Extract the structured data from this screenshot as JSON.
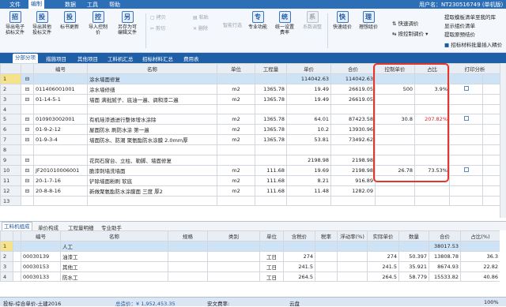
{
  "menu": {
    "file": "文件",
    "edit": "编制",
    "data": "数据",
    "tools": "工具",
    "help": "帮助",
    "user": "用户名：NT230516749 (单机版)"
  },
  "toolbar": {
    "btn1": "导出电子\n招标文件",
    "btn2": "导出其他\n投标文件",
    "btn3": "标书更新",
    "btn4": "导入控制\n价",
    "btn5": "另存为可\n编辑文件",
    "copy": "拷贝",
    "paste": "粘贴",
    "cut": "剪切",
    "del": "删除",
    "smart": "智能行选",
    "pro": "专业功能",
    "unify": "统一设置\n费率",
    "sys": "系数调整",
    "fast": "快速组价",
    "ideal": "理想组价",
    "fast_adjust": "快速调价",
    "ctrl_adjust": "按控制调价",
    "r1": "提取模板清单至我的库",
    "r2": "显示组价清单",
    "r3": "提取原预结价",
    "r4": "招标材料批量插入精价"
  },
  "main_tabs": [
    "分部分项",
    "措施项目",
    "其他项目",
    "工料机汇总",
    "招标材料汇总",
    "费用表"
  ],
  "grid1": {
    "headers": [
      "编号",
      "名称",
      "单位",
      "工程量",
      "单价",
      "合价",
      "控制单价",
      "占比",
      "打印分析"
    ],
    "rows": [
      {
        "n": "1",
        "code": "",
        "name": "涂水墙面修复",
        "unit": "",
        "qty": "",
        "price": "114042.63",
        "total": "114042.63",
        "cp": "",
        "pct": "",
        "cb": false,
        "sel": true
      },
      {
        "n": "2",
        "code": "011406001001",
        "name": "涂水墙修缮",
        "unit": "m2",
        "qty": "1365.78",
        "price": "19.49",
        "total": "26619.05",
        "cp": "500",
        "pct": "3.9%",
        "cb": true
      },
      {
        "n": "3",
        "code": "01-14-5-1",
        "name": "墙面 满批腻子、底油一遍、调和漆二遍",
        "unit": "m2",
        "qty": "1365.78",
        "price": "19.49",
        "total": "26619.05",
        "cp": "",
        "pct": "",
        "cb": false
      },
      {
        "n": "4",
        "code": "",
        "name": "",
        "unit": "",
        "qty": "",
        "price": "",
        "total": "",
        "cp": "",
        "pct": "",
        "cb": false
      },
      {
        "n": "5",
        "code": "010903002001",
        "name": "有机硅渗透进行整体增水涂除",
        "unit": "m2",
        "qty": "1365.78",
        "price": "64.01",
        "total": "87423.58",
        "cp": "30.8",
        "pct": "207.82%",
        "cb": true
      },
      {
        "n": "6",
        "code": "01-9-2-12",
        "name": "屋面防水 刷防水涂 第一遍",
        "unit": "m2",
        "qty": "1365.78",
        "price": "10.2",
        "total": "13930.96",
        "cp": "",
        "pct": "",
        "cb": false
      },
      {
        "n": "7",
        "code": "01-9-3-4",
        "name": "墙面防水、防潮 聚氨酯防水涂膜 2.0mm厚",
        "unit": "m2",
        "qty": "1365.78",
        "price": "53.81",
        "total": "73492.62",
        "cp": "",
        "pct": "",
        "cb": false
      },
      {
        "n": "8",
        "code": "",
        "name": "",
        "unit": "",
        "qty": "",
        "price": "",
        "total": "",
        "cp": "",
        "pct": "",
        "cb": false
      },
      {
        "n": "9",
        "code": "",
        "name": "花岗石窗台、立柱、勒脚、墙面修复",
        "unit": "",
        "qty": "",
        "price": "2198.98",
        "total": "2198.98",
        "cp": "",
        "pct": "",
        "cb": false
      },
      {
        "n": "10",
        "code": "JF201010006001",
        "name": "脆漆刺墙洗墙面",
        "unit": "m2",
        "qty": "111.68",
        "price": "19.69",
        "total": "2198.98",
        "cp": "26.78",
        "pct": "73.53%",
        "cb": true
      },
      {
        "n": "11",
        "code": "20-1-7-16",
        "name": "铲除墙面粉刷 软底",
        "unit": "m2",
        "qty": "111.68",
        "price": "8.21",
        "total": "916.89",
        "cp": "",
        "pct": "",
        "cb": false
      },
      {
        "n": "12",
        "code": "20-8-8-16",
        "name": "新做聚氨酯防水涂膜面 三度 厚2",
        "unit": "m2",
        "qty": "111.68",
        "price": "11.48",
        "total": "1282.09",
        "cp": "",
        "pct": "",
        "cb": false
      },
      {
        "n": "13",
        "code": "",
        "name": "",
        "unit": "",
        "qty": "",
        "price": "",
        "total": "",
        "cp": "",
        "pct": "",
        "cb": false
      }
    ]
  },
  "panel_tabs": [
    "工料机组成",
    "单价构成",
    "工程量明细",
    "专业助手"
  ],
  "grid2": {
    "headers": [
      "编号",
      "名称",
      "规格",
      "类别",
      "单位",
      "含税价",
      "税率",
      "浮动率(%)",
      "实际单价",
      "数量",
      "合价",
      "占比(%)"
    ],
    "rows": [
      {
        "n": "1",
        "code": "",
        "name": "人工",
        "spec": "",
        "type": "",
        "unit": "",
        "tp": "",
        "tax": "",
        "fl": "",
        "ap": "",
        "qty": "",
        "total": "38017.53",
        "pct": "",
        "sel": true
      },
      {
        "n": "2",
        "code": "00030139",
        "name": "油漆工",
        "spec": "",
        "type": "",
        "unit": "工日",
        "tp": "274",
        "tax": "",
        "fl": "",
        "ap": "274",
        "qty": "50.397",
        "total": "13808.78",
        "pct": "36.3"
      },
      {
        "n": "3",
        "code": "00030153",
        "name": "其他工",
        "spec": "",
        "type": "",
        "unit": "工日",
        "tp": "241.5",
        "tax": "",
        "fl": "",
        "ap": "241.5",
        "qty": "35.921",
        "total": "8674.93",
        "pct": "22.82"
      },
      {
        "n": "4",
        "code": "00030133",
        "name": "防水工",
        "spec": "",
        "type": "",
        "unit": "工日",
        "tp": "264.5",
        "tax": "",
        "fl": "",
        "ap": "264.5",
        "qty": "58.779",
        "total": "15533.82",
        "pct": "40.86"
      }
    ]
  },
  "status": {
    "mode": "投标-综合单价-土建2016",
    "total_label": "总造价：¥ 1,952,453.35",
    "safe_label": "安文费率:",
    "region": "云盘",
    "signal": "100%"
  }
}
